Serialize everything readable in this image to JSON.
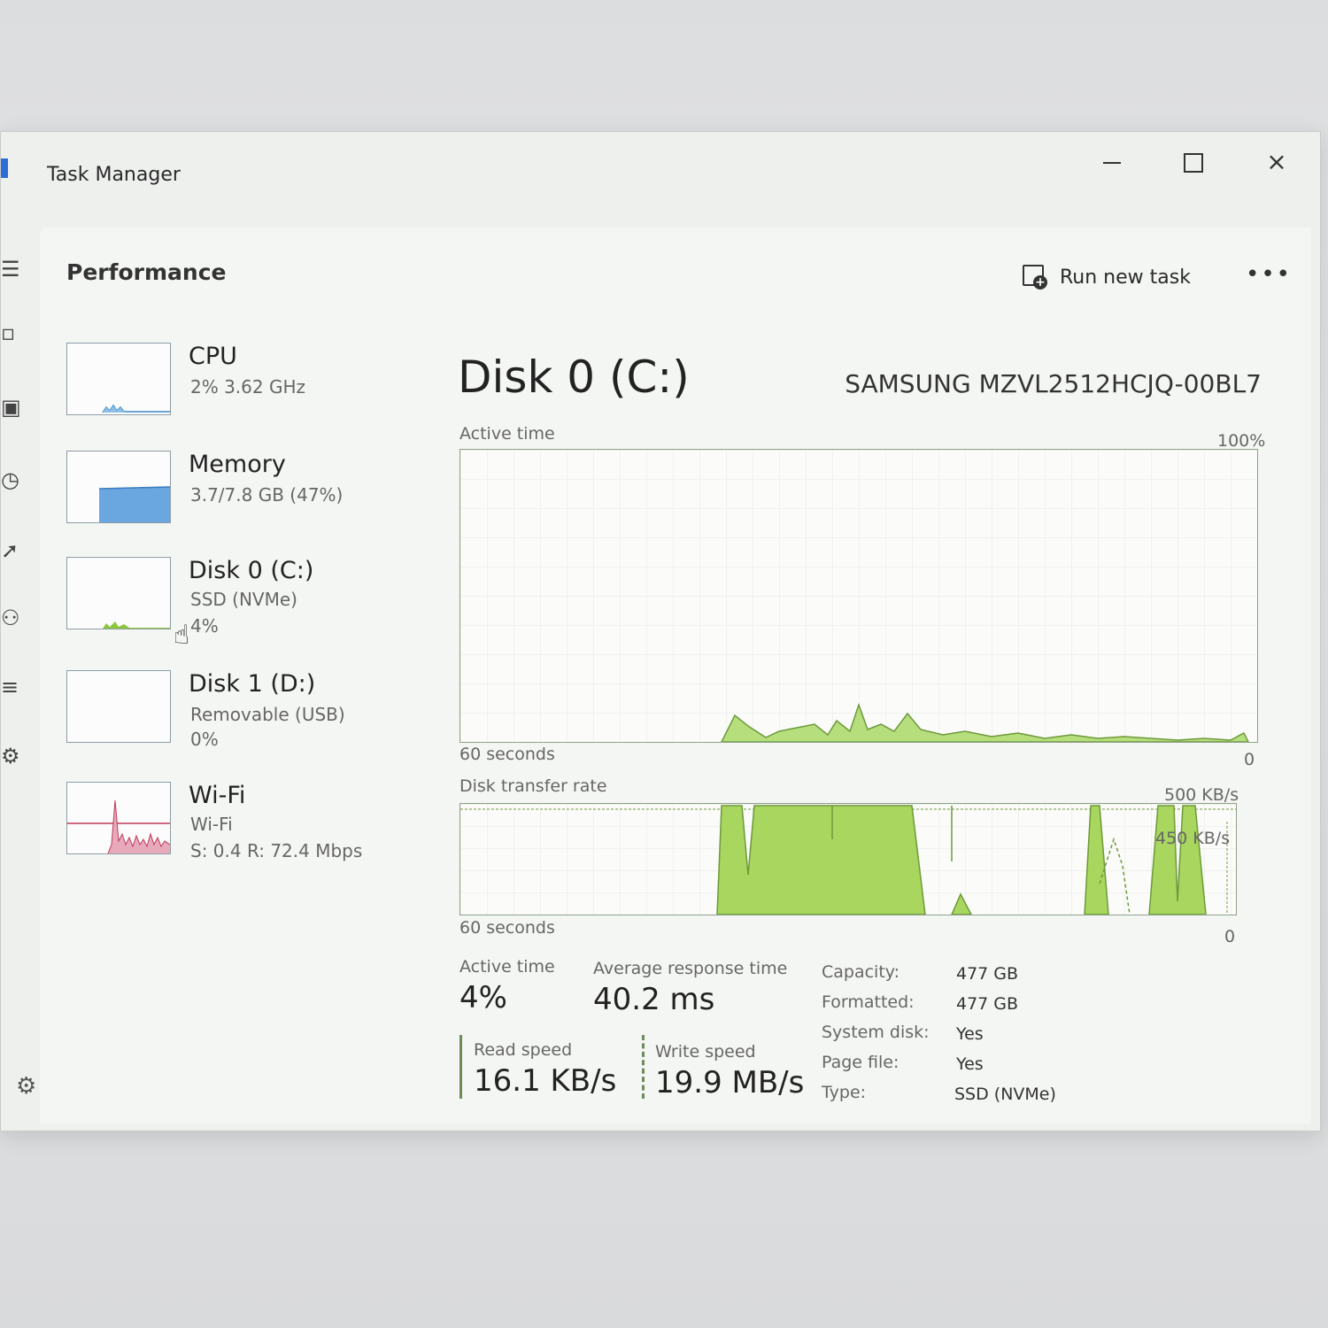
{
  "window": {
    "title": "Task Manager",
    "minimize_label": "",
    "maximize_label": "",
    "close_label": "×"
  },
  "header": {
    "page_title": "Performance",
    "run_new_task": "Run new task",
    "more": "•••"
  },
  "sidebar": {
    "items": [
      {
        "name": "CPU",
        "sub1": "2% 3.62 GHz",
        "sub2": "",
        "sub3": "",
        "color": "#3a88c6"
      },
      {
        "name": "Memory",
        "sub1": "3.7/7.8 GB (47%)",
        "sub2": "",
        "sub3": "",
        "color": "#5a93d6"
      },
      {
        "name": "Disk 0 (C:)",
        "sub1": "SSD (NVMe)",
        "sub2": "4%",
        "sub3": "",
        "color": "#6ca63c"
      },
      {
        "name": "Disk 1 (D:)",
        "sub1": "Removable (USB)",
        "sub2": "0%",
        "sub3": "",
        "color": "#6ca63c"
      },
      {
        "name": "Wi-Fi",
        "sub1": "Wi-Fi",
        "sub2": "S: 0.4 R: 72.4 Mbps",
        "sub3": "",
        "color": "#c0395a"
      }
    ]
  },
  "main": {
    "disk_title": "Disk 0 (C:)",
    "model": "SAMSUNG MZVL2512HCJQ-00BL7",
    "active_chart": {
      "label": "Active time",
      "max": "100%",
      "x_left": "60 seconds",
      "x_right": "0"
    },
    "transfer_chart": {
      "label": "Disk transfer rate",
      "max": "500 KB/s",
      "ref_line": "450 KB/s",
      "x_left": "60 seconds",
      "x_right": "0"
    },
    "stats": {
      "active_time_label": "Active time",
      "active_time_value": "4%",
      "avg_response_label": "Average response time",
      "avg_response_value": "40.2 ms",
      "read_label": "Read speed",
      "read_value": "16.1 KB/s",
      "write_label": "Write speed",
      "write_value": "19.9 MB/s"
    },
    "properties": [
      {
        "key": "Capacity:",
        "value": "477 GB"
      },
      {
        "key": "Formatted:",
        "value": "477 GB"
      },
      {
        "key": "System disk:",
        "value": "Yes"
      },
      {
        "key": "Page file:",
        "value": "Yes"
      },
      {
        "key": "Type:",
        "value": "SSD (NVMe)"
      }
    ]
  },
  "colors": {
    "disk_green": "#8cc63f",
    "disk_line": "#6d9a3a",
    "memory_blue": "#6aa6e0",
    "wifi_red": "#c0395a"
  },
  "icons": [
    "app-icon",
    "minimize-icon",
    "maximize-icon",
    "close-icon",
    "run-new-task-icon",
    "more-icon",
    "processes-icon",
    "performance-icon",
    "app-history-icon",
    "startup-apps-icon",
    "users-icon",
    "details-icon",
    "services-icon",
    "settings-icon",
    "hand-cursor-icon"
  ]
}
